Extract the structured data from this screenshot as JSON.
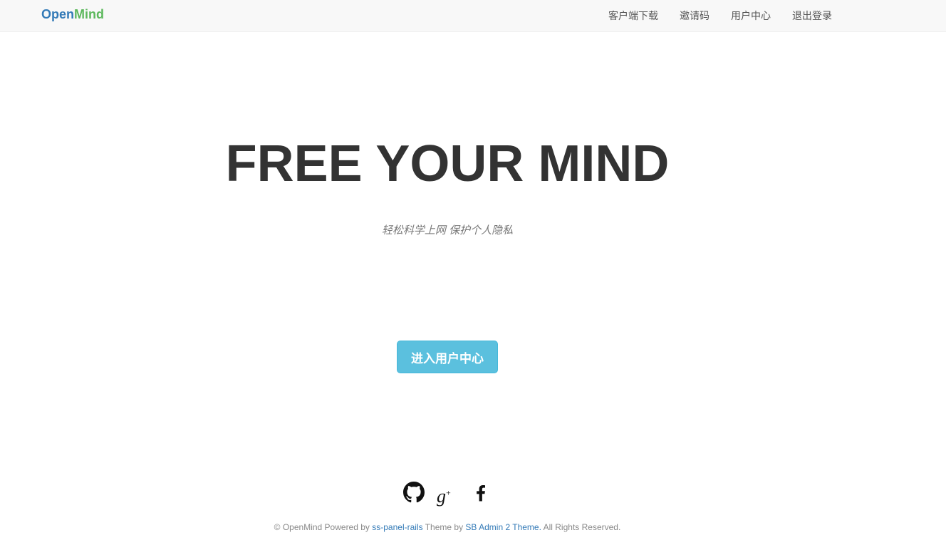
{
  "navbar": {
    "brand_part1": "Open",
    "brand_part2": "Mind",
    "links": [
      "客户端下载",
      "邀请码",
      "用户中心",
      "退出登录"
    ]
  },
  "hero": {
    "title": "FREE YOUR MIND",
    "subtitle": "轻松科学上网 保护个人隐私",
    "cta_label": "进入用户中心"
  },
  "social": {
    "icons": [
      "github-icon",
      "google-plus-icon",
      "facebook-icon"
    ],
    "gplus_letter": "g",
    "gplus_plus": "+"
  },
  "footer": {
    "prefix": "© OpenMind Powered by ",
    "link1": "ss-panel-rails",
    "middle": " Theme by ",
    "link2": "SB Admin 2 Theme.",
    "suffix": " All Rights Reserved."
  },
  "colors": {
    "brand_open": "#337ab7",
    "brand_mind": "#5cb85c",
    "cta_bg": "#5bc0de",
    "navbar_bg": "#f8f8f8",
    "title": "#333333"
  }
}
